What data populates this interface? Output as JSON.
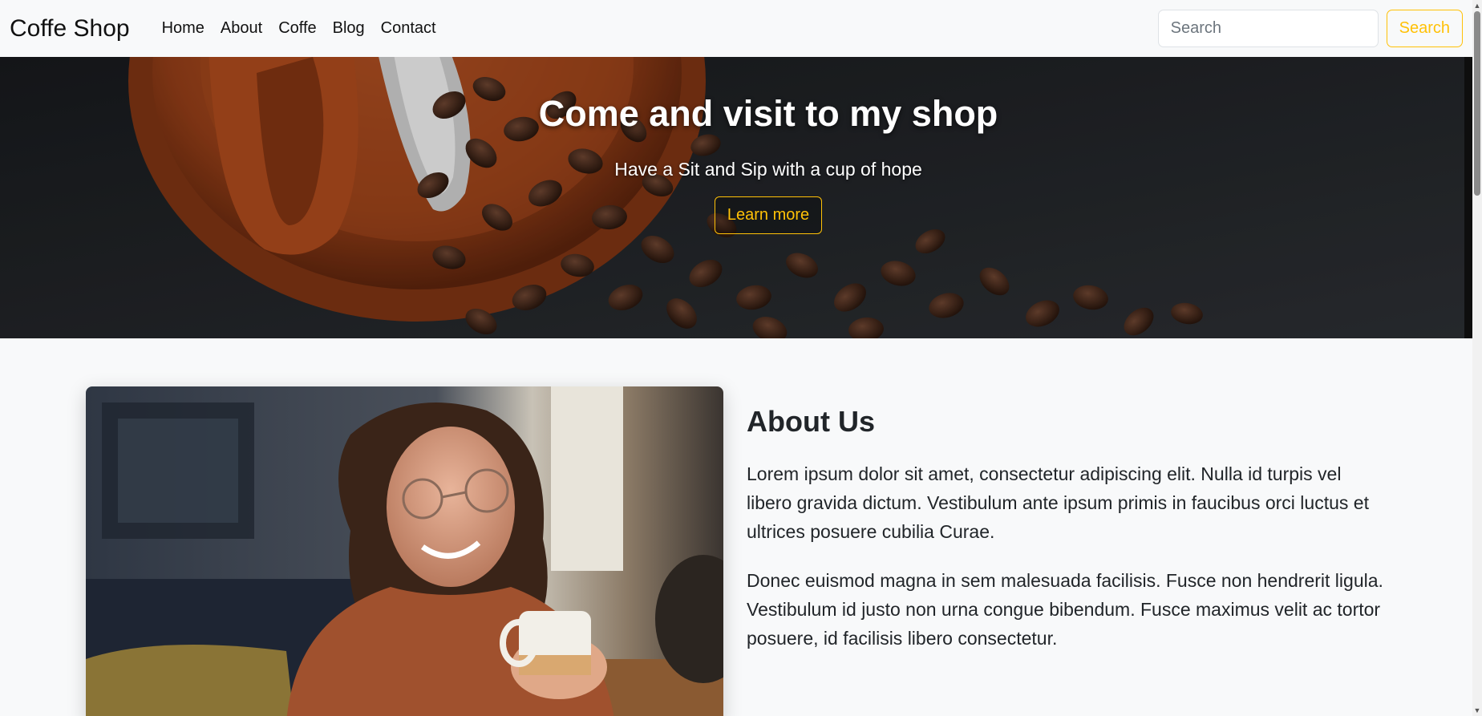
{
  "navbar": {
    "brand": "Coffe Shop",
    "links": [
      "Home",
      "About",
      "Coffe",
      "Blog",
      "Contact"
    ],
    "search_placeholder": "Search",
    "search_button": "Search"
  },
  "hero": {
    "title": "Come and visit to my shop",
    "subtitle": "Have a Sit and Sip with a cup of hope",
    "button": "Learn more"
  },
  "about": {
    "title": "About Us",
    "paragraphs": [
      "Lorem ipsum dolor sit amet, consectetur adipiscing elit. Nulla id turpis vel libero gravida dictum. Vestibulum ante ipsum primis in faucibus orci luctus et ultrices posuere cubilia Curae.",
      "Donec euismod magna in sem malesuada facilisis. Fusce non hendrerit ligula. Vestibulum id justo non urna congue bibendum. Fusce maximus velit ac tortor posuere, id facilisis libero consectetur."
    ]
  },
  "colors": {
    "accent": "#ffc107",
    "background": "#f8f9fa",
    "text": "#212529"
  }
}
